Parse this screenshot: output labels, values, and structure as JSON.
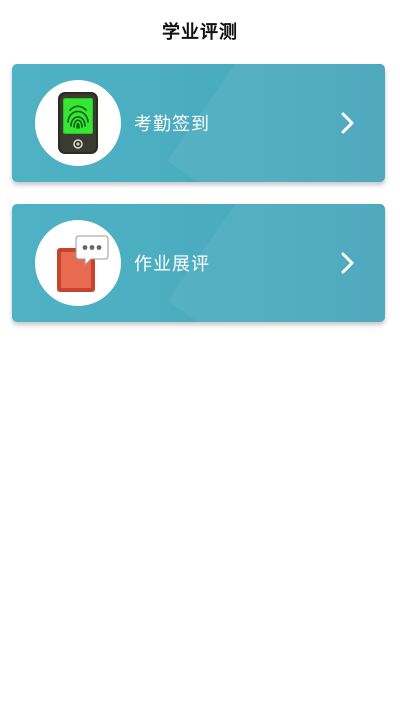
{
  "header": {
    "title": "学业评测"
  },
  "cards": [
    {
      "label": "考勤签到",
      "icon": "fingerprint-scanner-icon"
    },
    {
      "label": "作业展评",
      "icon": "homework-chat-icon"
    }
  ],
  "colors": {
    "card_background": "#4aabbf",
    "card_text": "#ffffff",
    "fingerprint_green": "#2ee02e",
    "homework_red": "#e2553e"
  }
}
